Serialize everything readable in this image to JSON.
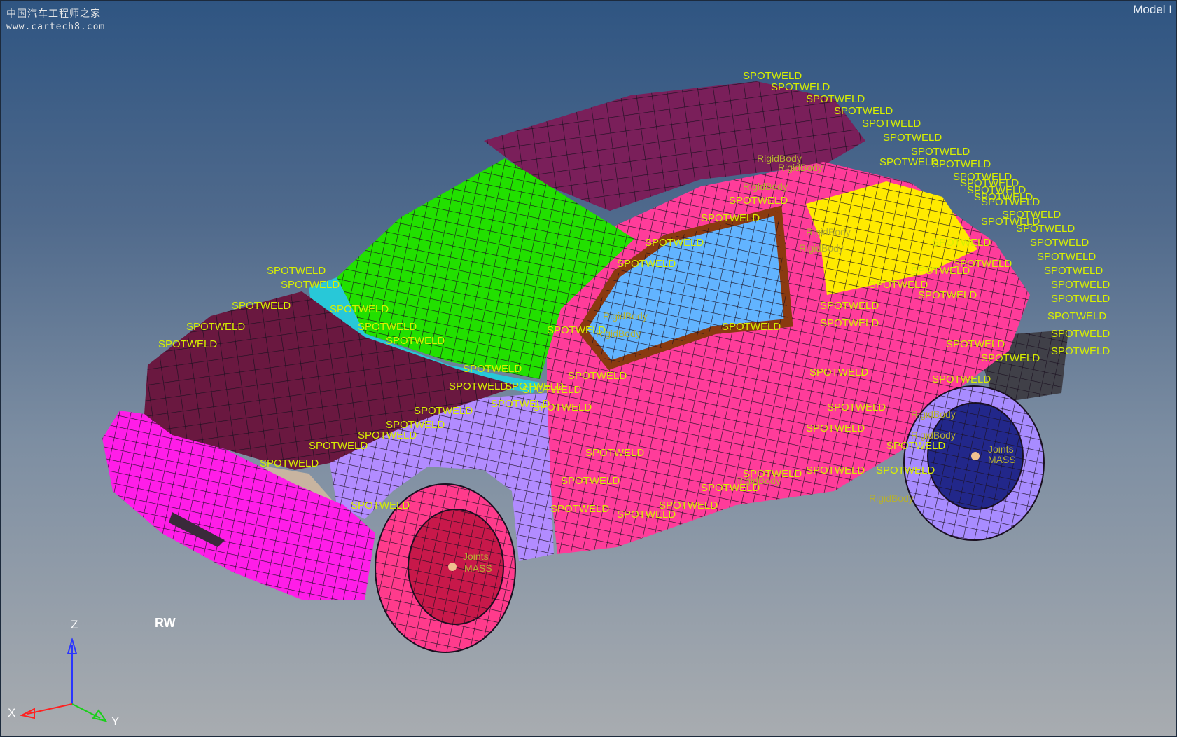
{
  "watermark": {
    "line1": "中国汽车工程师之家",
    "line2": "www.cartech8.com"
  },
  "viewport": {
    "model_label": "Model I",
    "marker": "RW"
  },
  "labels": {
    "spotweld": "SPOTWELD",
    "rigid": "RigidBody",
    "joints": "Joints",
    "mass": "MASS"
  },
  "axes": {
    "x": "X",
    "y": "Y",
    "z": "Z"
  },
  "colors": {
    "roof": "#7a1f5a",
    "hood": "#6a1840",
    "windshield": "#22e000",
    "door": "#ff3c9a",
    "window": "#62b4ff",
    "rear_window": "#ffea00",
    "fender": "#b28cff",
    "bumper": "#ff1de8",
    "front_wheel": "#ff3b8c",
    "rear_wheel": "#a88cff",
    "hub": "#22278a",
    "label": "#d8f000"
  }
}
